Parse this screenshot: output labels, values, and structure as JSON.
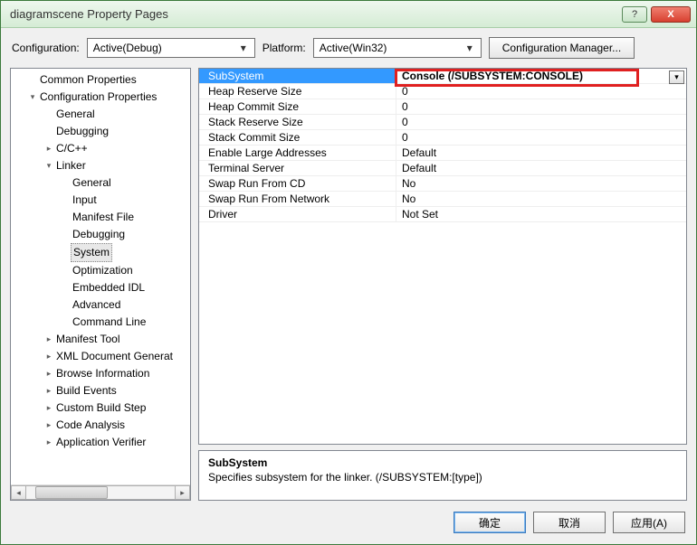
{
  "window": {
    "title": "diagramscene Property Pages"
  },
  "titlebar": {
    "help": "?",
    "close": "X"
  },
  "toolbar": {
    "configuration_label": "Configuration:",
    "configuration_value": "Active(Debug)",
    "platform_label": "Platform:",
    "platform_value": "Active(Win32)",
    "config_manager": "Configuration Manager..."
  },
  "tree": [
    {
      "indent": 0,
      "expander": "",
      "label": "Common Properties",
      "name": "common-properties"
    },
    {
      "indent": 0,
      "expander": "▾",
      "label": "Configuration Properties",
      "name": "configuration-properties"
    },
    {
      "indent": 1,
      "expander": "",
      "label": "General",
      "name": "cfg-general"
    },
    {
      "indent": 1,
      "expander": "",
      "label": "Debugging",
      "name": "cfg-debugging"
    },
    {
      "indent": 1,
      "expander": "▸",
      "label": "C/C++",
      "name": "cfg-ccpp"
    },
    {
      "indent": 1,
      "expander": "▾",
      "label": "Linker",
      "name": "cfg-linker"
    },
    {
      "indent": 2,
      "expander": "",
      "label": "General",
      "name": "linker-general"
    },
    {
      "indent": 2,
      "expander": "",
      "label": "Input",
      "name": "linker-input"
    },
    {
      "indent": 2,
      "expander": "",
      "label": "Manifest File",
      "name": "linker-manifest"
    },
    {
      "indent": 2,
      "expander": "",
      "label": "Debugging",
      "name": "linker-debugging"
    },
    {
      "indent": 2,
      "expander": "",
      "label": "System",
      "name": "linker-system",
      "selected": true
    },
    {
      "indent": 2,
      "expander": "",
      "label": "Optimization",
      "name": "linker-optimization"
    },
    {
      "indent": 2,
      "expander": "",
      "label": "Embedded IDL",
      "name": "linker-embedded-idl"
    },
    {
      "indent": 2,
      "expander": "",
      "label": "Advanced",
      "name": "linker-advanced"
    },
    {
      "indent": 2,
      "expander": "",
      "label": "Command Line",
      "name": "linker-cmdline"
    },
    {
      "indent": 1,
      "expander": "▸",
      "label": "Manifest Tool",
      "name": "manifest-tool"
    },
    {
      "indent": 1,
      "expander": "▸",
      "label": "XML Document Generat",
      "name": "xml-doc-gen"
    },
    {
      "indent": 1,
      "expander": "▸",
      "label": "Browse Information",
      "name": "browse-info"
    },
    {
      "indent": 1,
      "expander": "▸",
      "label": "Build Events",
      "name": "build-events"
    },
    {
      "indent": 1,
      "expander": "▸",
      "label": "Custom Build Step",
      "name": "custom-build-step"
    },
    {
      "indent": 1,
      "expander": "▸",
      "label": "Code Analysis",
      "name": "code-analysis"
    },
    {
      "indent": 1,
      "expander": "▸",
      "label": "Application Verifier",
      "name": "app-verifier"
    }
  ],
  "grid": {
    "selected_index": 0,
    "rows": [
      {
        "name": "SubSystem",
        "value": "Console (/SUBSYSTEM:CONSOLE)"
      },
      {
        "name": "Heap Reserve Size",
        "value": "0"
      },
      {
        "name": "Heap Commit Size",
        "value": "0"
      },
      {
        "name": "Stack Reserve Size",
        "value": "0"
      },
      {
        "name": "Stack Commit Size",
        "value": "0"
      },
      {
        "name": "Enable Large Addresses",
        "value": "Default"
      },
      {
        "name": "Terminal Server",
        "value": "Default"
      },
      {
        "name": "Swap Run From CD",
        "value": "No"
      },
      {
        "name": "Swap Run From Network",
        "value": "No"
      },
      {
        "name": "Driver",
        "value": "Not Set"
      }
    ]
  },
  "description": {
    "title": "SubSystem",
    "text": "Specifies subsystem for the linker.     (/SUBSYSTEM:[type])"
  },
  "footer": {
    "ok": "确定",
    "cancel": "取消",
    "apply": "应用(A)"
  }
}
